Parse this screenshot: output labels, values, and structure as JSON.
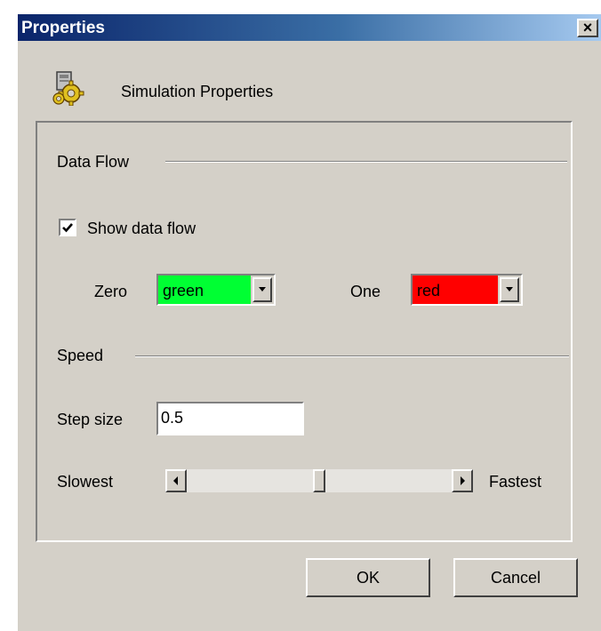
{
  "window": {
    "title": "Properties",
    "close_glyph": "×"
  },
  "header": {
    "icon": "settings-gear-icon",
    "title": "Simulation Properties"
  },
  "data_flow": {
    "section_label": "Data Flow",
    "show_checkbox_label": "Show data flow",
    "show_checked": true,
    "zero": {
      "label": "Zero",
      "value": "green",
      "color": "#00ff33"
    },
    "one": {
      "label": "One",
      "value": "red",
      "color": "#ff0000"
    }
  },
  "speed": {
    "section_label": "Speed",
    "step_size_label": "Step size",
    "step_size_value": "0.5",
    "slowest_label": "Slowest",
    "fastest_label": "Fastest",
    "slider_position": 0.5
  },
  "buttons": {
    "ok": "OK",
    "cancel": "Cancel"
  }
}
